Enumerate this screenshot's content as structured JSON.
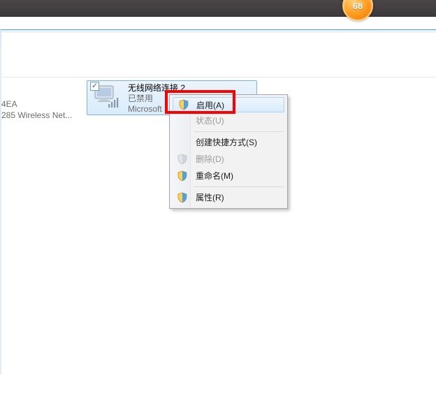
{
  "badge": {
    "count": "68"
  },
  "left_info": {
    "line1": "4EA",
    "line2": "285 Wireless Net..."
  },
  "tile": {
    "title": "无线网络连接 2",
    "status": "已禁用",
    "vendor": "Microsoft"
  },
  "menu": {
    "enable": "启用(A)",
    "status": "状态(U)",
    "shortcut": "创建快捷方式(S)",
    "delete": "删除(D)",
    "rename": "重命名(M)",
    "properties": "属性(R)"
  }
}
